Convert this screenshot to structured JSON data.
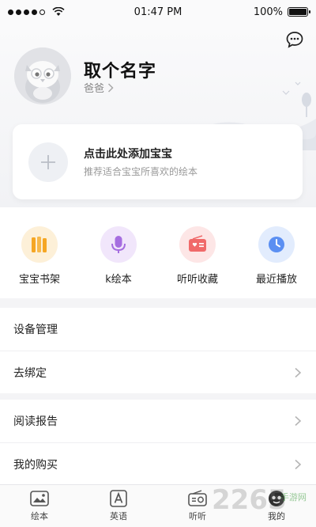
{
  "status_bar": {
    "time": "01:47 PM",
    "battery": "100%",
    "battery_level": 1.0
  },
  "profile": {
    "name": "取个名字",
    "role": "爸爸"
  },
  "add_child": {
    "title": "点击此处添加宝宝",
    "subtitle": "推荐适合宝宝所喜欢的绘本"
  },
  "quick_actions": [
    {
      "label": "宝宝书架",
      "icon": "bookshelf-icon",
      "color": "#f5a623"
    },
    {
      "label": "k绘本",
      "icon": "microphone-icon",
      "color": "#a66ee0"
    },
    {
      "label": "听听收藏",
      "icon": "radio-icon",
      "color": "#f06a6a"
    },
    {
      "label": "最近播放",
      "icon": "clock-icon",
      "color": "#5b8ff2"
    }
  ],
  "menu_groups": [
    [
      {
        "label": "设备管理"
      },
      {
        "label": "去绑定"
      }
    ],
    [
      {
        "label": "阅读报告"
      },
      {
        "label": "我的购买"
      }
    ]
  ],
  "tab_bar": [
    {
      "label": "绘本",
      "icon": "picture-book-icon"
    },
    {
      "label": "英语",
      "icon": "english-icon"
    },
    {
      "label": "听听",
      "icon": "radio-listen-icon"
    },
    {
      "label": "我的",
      "icon": "profile-icon"
    }
  ],
  "watermark": {
    "text": "2265",
    "site": "手游网"
  }
}
